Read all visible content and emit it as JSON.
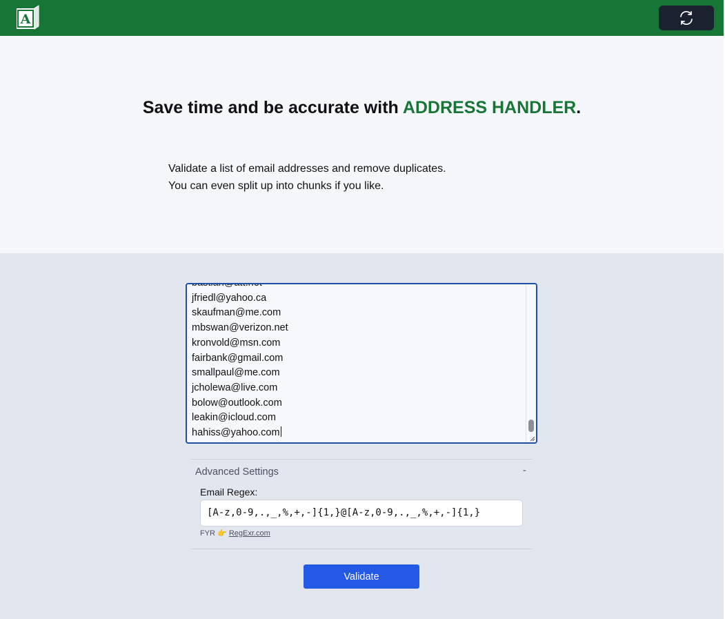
{
  "header": {
    "logo_icon": "address-book-icon",
    "logo_letter": "A",
    "refresh_icon": "refresh-icon",
    "background_color": "#177535"
  },
  "hero": {
    "headline_prefix": "Save time and be accurate with ",
    "headline_brand": "ADDRESS HANDLER",
    "headline_suffix": ".",
    "intro_line1": "Validate a list of email addresses and remove duplicates.",
    "intro_line2": "You can even split up into chunks if you like."
  },
  "email_input": {
    "lines": [
      "bastian@att.net",
      "jfriedl@yahoo.ca",
      "skaufman@me.com",
      "mbswan@verizon.net",
      "kronvold@msn.com",
      "fairbank@gmail.com",
      "smallpaul@me.com",
      "jcholewa@live.com",
      "bolow@outlook.com",
      "leakin@icloud.com",
      "hahiss@yahoo.com"
    ]
  },
  "advanced": {
    "title": "Advanced Settings",
    "toggle": "-",
    "regex_label": "Email Regex:",
    "regex_value": "[A-z,0-9,.,_,%,+,-]{1,}@[A-z,0-9,.,_,%,+,-]{1,}",
    "fyr_prefix": "FYR",
    "fyr_icon": "pointing-hand-icon",
    "fyr_link": "RegExr.com"
  },
  "actions": {
    "validate_label": "Validate",
    "accent_color": "#2459e6"
  }
}
